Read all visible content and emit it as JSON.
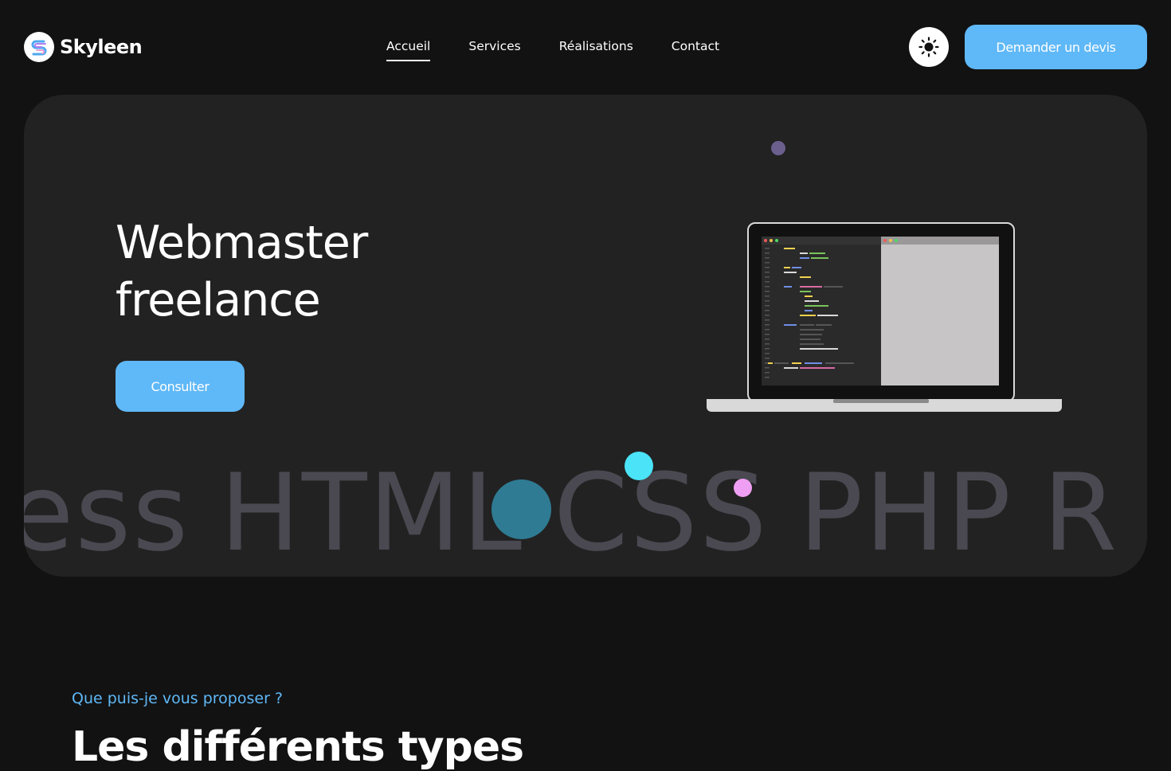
{
  "header": {
    "brand": "Skyleen",
    "nav": [
      {
        "label": "Accueil",
        "active": true
      },
      {
        "label": "Services",
        "active": false
      },
      {
        "label": "Réalisations",
        "active": false
      },
      {
        "label": "Contact",
        "active": false
      }
    ],
    "theme_toggle_icon": "sun-icon",
    "cta_label": "Demander un devis"
  },
  "hero": {
    "title_line1": "Webmaster",
    "title_line2": "freelance",
    "button_label": "Consulter",
    "marquee": [
      "ess",
      "HTML",
      "CSS",
      "PHP",
      "R"
    ]
  },
  "section": {
    "kicker": "Que puis-je vous proposer ?",
    "title": "Les différents types"
  },
  "colors": {
    "accent": "#5fb8f7",
    "background": "#121212",
    "hero_card": "#222222",
    "marquee_text": "#4a4951"
  }
}
